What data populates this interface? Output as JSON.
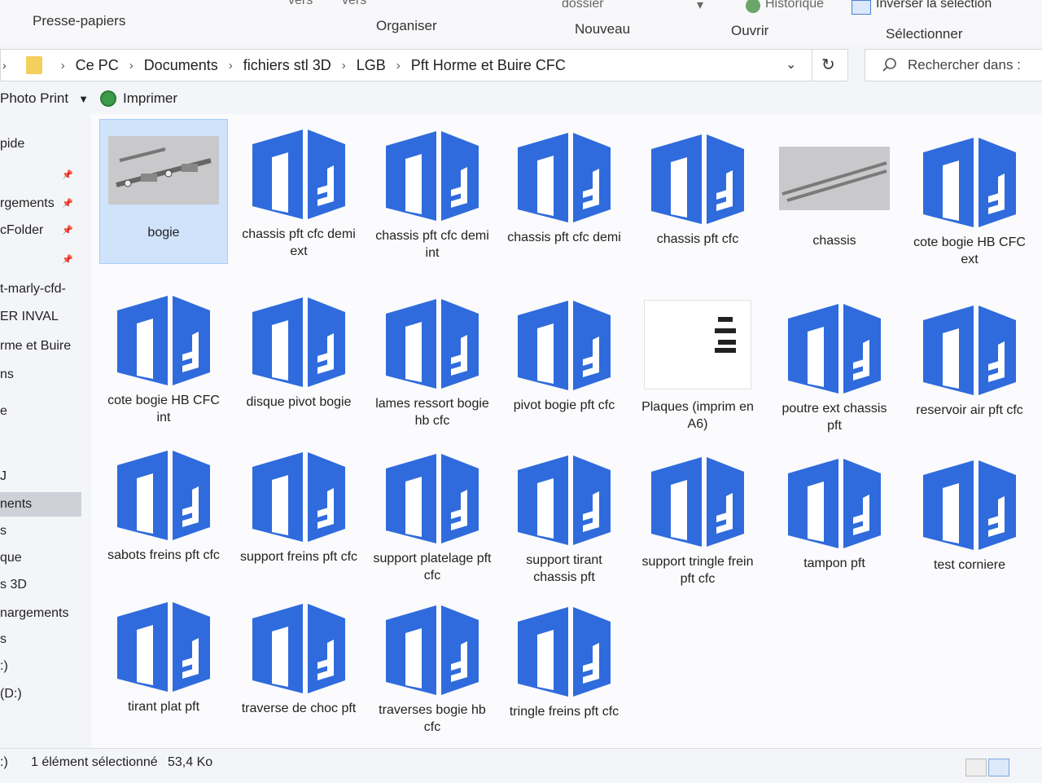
{
  "ribbon": {
    "clipboard_label": "Presse-papiers",
    "organize_label": "Organiser",
    "new_label": "Nouveau",
    "open_label": "Ouvrir",
    "select_label": "Sélectionner",
    "cut_vers_1": "vers",
    "cut_vers_2": "vers",
    "cut_folder": "dossier",
    "history_label": "Historique",
    "invert_selection_label": "Inverser la sélection"
  },
  "address": {
    "crumbs": [
      "Ce PC",
      "Documents",
      "fichiers stl 3D",
      "LGB",
      "Pft Horme et Buire CFC"
    ]
  },
  "search": {
    "placeholder": "Rechercher dans :"
  },
  "commands": {
    "photo_print": "Photo Print",
    "print": "Imprimer"
  },
  "sidebar": {
    "items": [
      {
        "label": "pide",
        "pinned": false
      },
      {
        "label": "",
        "pinned": true
      },
      {
        "label": "rgements",
        "pinned": true
      },
      {
        "label": "cFolder",
        "pinned": true
      },
      {
        "label": "",
        "pinned": true
      },
      {
        "label": "t-marly-cfd-",
        "pinned": false
      },
      {
        "label": "ER INVAL",
        "pinned": false
      },
      {
        "label": "rme et Buire",
        "pinned": false
      },
      {
        "label": "ns",
        "pinned": false
      },
      {
        "label": "e",
        "pinned": false
      },
      {
        "label": "",
        "pinned": false
      },
      {
        "label": "J",
        "pinned": false
      },
      {
        "label": "nents",
        "pinned": false
      },
      {
        "label": "s",
        "pinned": false
      },
      {
        "label": "que",
        "pinned": false
      },
      {
        "label": "s 3D",
        "pinned": false
      },
      {
        "label": "nargements",
        "pinned": false
      },
      {
        "label": "s",
        "pinned": false
      },
      {
        "label": ":)",
        "pinned": false
      },
      {
        "label": "(D:)",
        "pinned": false
      }
    ]
  },
  "files": [
    {
      "name": "bogie",
      "icon": "bogie-thumbnail",
      "selected": true
    },
    {
      "name": "chassis pft cfc demi ext",
      "icon": "stl-file-icon"
    },
    {
      "name": "chassis pft cfc demi int",
      "icon": "stl-file-icon"
    },
    {
      "name": "chassis pft cfc demi",
      "icon": "stl-file-icon"
    },
    {
      "name": "chassis pft cfc",
      "icon": "stl-file-icon"
    },
    {
      "name": "chassis",
      "icon": "chassis-thumbnail"
    },
    {
      "name": "cote bogie HB CFC ext",
      "icon": "stl-file-icon"
    },
    {
      "name": "cote bogie HB CFC int",
      "icon": "stl-file-icon"
    },
    {
      "name": "disque pivot bogie",
      "icon": "stl-file-icon"
    },
    {
      "name": "lames ressort bogie hb cfc",
      "icon": "stl-file-icon"
    },
    {
      "name": "pivot bogie pft cfc",
      "icon": "stl-file-icon"
    },
    {
      "name": "Plaques (imprim en A6)",
      "icon": "plaques-thumbnail"
    },
    {
      "name": "poutre ext chassis pft",
      "icon": "stl-file-icon"
    },
    {
      "name": "reservoir air pft cfc",
      "icon": "stl-file-icon"
    },
    {
      "name": "sabots freins pft cfc",
      "icon": "stl-file-icon"
    },
    {
      "name": "support freins pft cfc",
      "icon": "stl-file-icon"
    },
    {
      "name": "support platelage pft cfc",
      "icon": "stl-file-icon"
    },
    {
      "name": "support tirant chassis pft",
      "icon": "stl-file-icon"
    },
    {
      "name": "support tringle frein pft cfc",
      "icon": "stl-file-icon"
    },
    {
      "name": "tampon pft",
      "icon": "stl-file-icon"
    },
    {
      "name": "test corniere",
      "icon": "stl-file-icon"
    },
    {
      "name": "tirant plat pft",
      "icon": "stl-file-icon"
    },
    {
      "name": "traverse de choc pft",
      "icon": "stl-file-icon"
    },
    {
      "name": "traverses bogie hb cfc",
      "icon": "stl-file-icon"
    },
    {
      "name": "tringle freins pft cfc",
      "icon": "stl-file-icon"
    }
  ],
  "status": {
    "selection_text": "1 élément sélectionné",
    "size_text": "53,4 Ko",
    "left_fragment": ":)"
  },
  "colors": {
    "stl_icon_blue": "#2f6bdc",
    "selection_bg": "#cfe3fb"
  }
}
